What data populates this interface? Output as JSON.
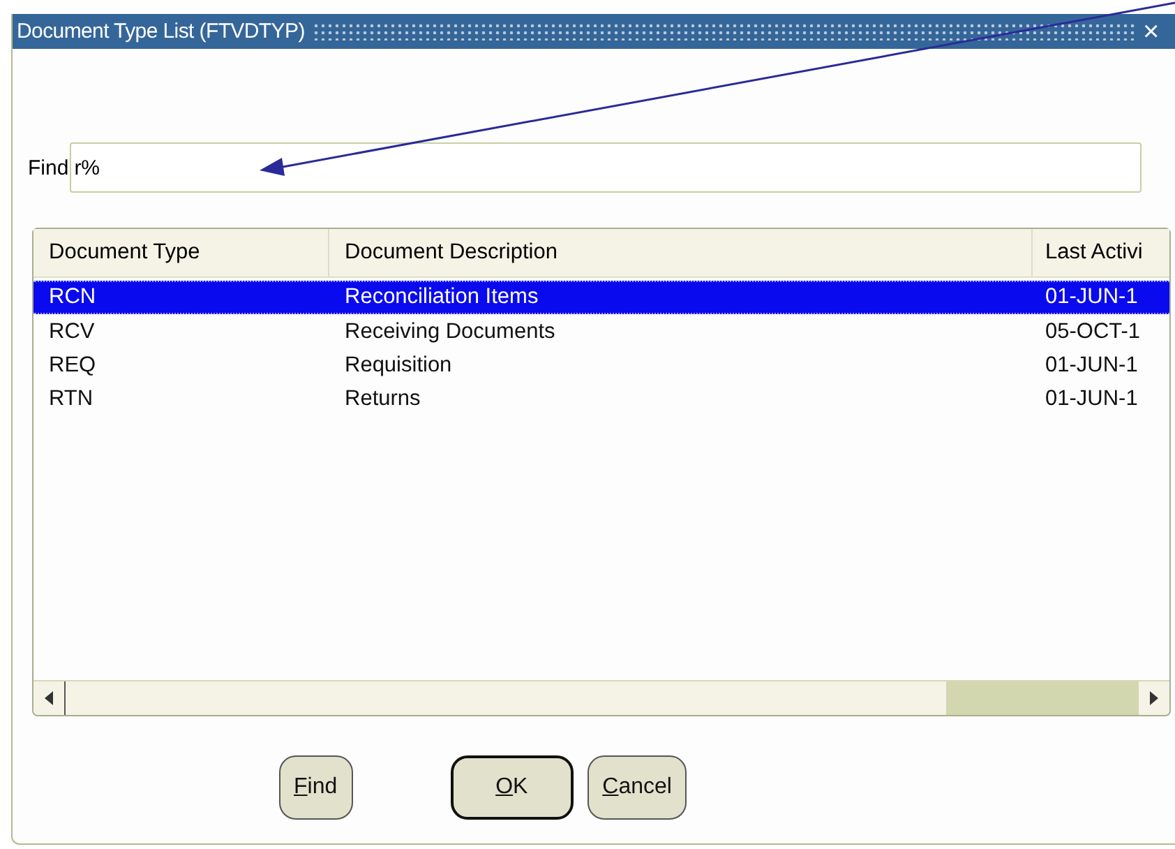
{
  "window": {
    "title": "Document Type List (FTVDTYP)",
    "close": "×"
  },
  "find": {
    "label": "Find",
    "value": "r%"
  },
  "table": {
    "columns": [
      "Document Type",
      "Document Description",
      "Last Activi"
    ],
    "rows": [
      {
        "cells": [
          "RCN",
          "Reconciliation Items",
          "01-JUN-1"
        ],
        "selected": true
      },
      {
        "cells": [
          "RCV",
          "Receiving Documents",
          "05-OCT-1"
        ],
        "selected": false
      },
      {
        "cells": [
          "REQ",
          "Requisition",
          "01-JUN-1"
        ],
        "selected": false
      },
      {
        "cells": [
          "RTN",
          "Returns",
          "01-JUN-1"
        ],
        "selected": false
      }
    ]
  },
  "buttons": [
    {
      "label": "Find",
      "default": false
    },
    {
      "label": "OK",
      "default": true
    },
    {
      "label": "Cancel",
      "default": false
    }
  ]
}
